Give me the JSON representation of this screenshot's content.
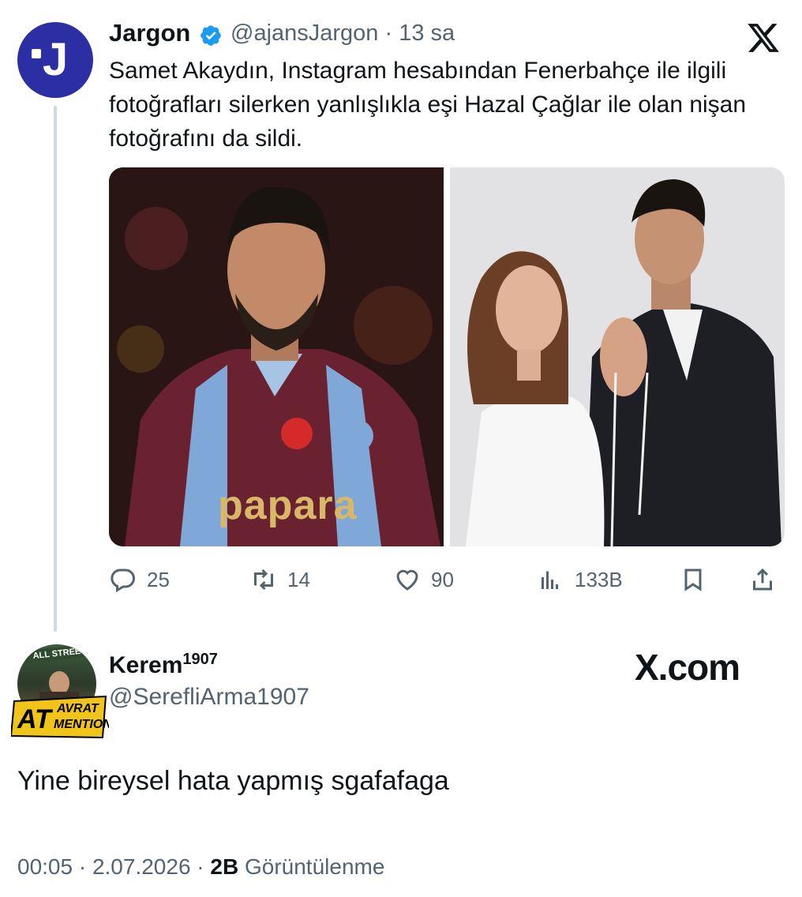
{
  "tweet": {
    "author_name": "Jargon",
    "author_handle": "@ajansJargon",
    "separator": " · ",
    "time": "13 sa",
    "text": "Samet Akaydın, Instagram hesabından Fenerbahçe ile ilgili fotoğrafları silerken yanlışlıkla eşi Hazal Çağlar ile olan nişan fotoğrafını da sildi.",
    "jersey_sponsor": "papara",
    "avatar_letter": "J",
    "actions": {
      "replies": "25",
      "retweets": "14",
      "likes": "90",
      "views": "133B"
    }
  },
  "reply": {
    "author_name": "Kerem",
    "author_name_sup": "1907",
    "author_handle": "@SerefliArma1907",
    "badge_top": "AVRAT",
    "badge_main": "AT",
    "badge_sub": "MENTION",
    "avatar_sign": "ALL STREE",
    "text": "Yine bireysel hata yapmış sgafafaga",
    "time": "00:05 · 2.07.2026 · ",
    "views_count": "2B",
    "views_label": " Görüntülenme"
  },
  "watermark": "X.com",
  "icons": [
    "verified-icon",
    "x-logo-icon",
    "reply-icon",
    "retweet-icon",
    "like-icon",
    "views-icon",
    "bookmark-icon",
    "share-icon"
  ],
  "colors": {
    "avatar_bg": "#2c2fa3",
    "verified": "#1d9bf0",
    "muted": "#536471",
    "text": "#0f1419"
  }
}
